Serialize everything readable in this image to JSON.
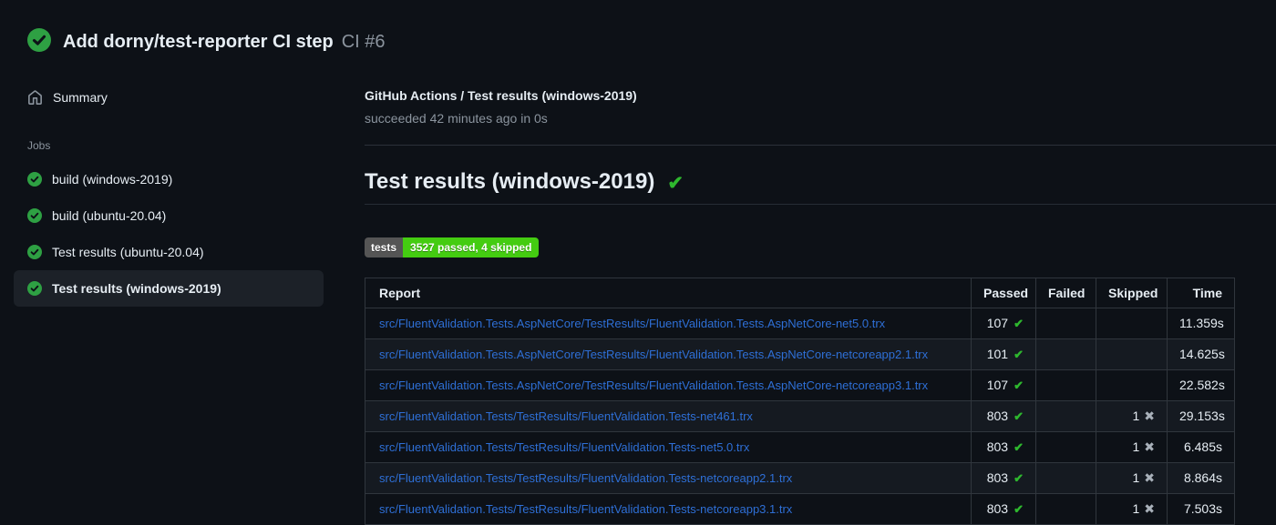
{
  "colors": {
    "success_circle": "#2ea043",
    "check_green": "#2eb82e",
    "link_blue": "#2e6fd6",
    "badge_label_bg": "#555555",
    "badge_value_bg": "#44cc11"
  },
  "run_header": {
    "title": "Add dorny/test-reporter CI step",
    "run_number": "CI #6"
  },
  "sidebar": {
    "summary_label": "Summary",
    "jobs_label": "Jobs",
    "jobs": [
      {
        "label": "build (windows-2019)",
        "status": "success",
        "selected": false
      },
      {
        "label": "build (ubuntu-20.04)",
        "status": "success",
        "selected": false
      },
      {
        "label": "Test results (ubuntu-20.04)",
        "status": "success",
        "selected": false
      },
      {
        "label": "Test results (windows-2019)",
        "status": "success",
        "selected": true
      }
    ]
  },
  "job_panel": {
    "breadcrumb": "GitHub Actions / Test results (windows-2019)",
    "status_line": "succeeded 42 minutes ago in 0s",
    "heading": "Test results (windows-2019)",
    "badge": {
      "label": "tests",
      "value": "3527 passed, 4 skipped"
    }
  },
  "results_table": {
    "columns": [
      "Report",
      "Passed",
      "Failed",
      "Skipped",
      "Time"
    ],
    "rows": [
      {
        "report": "src/FluentValidation.Tests.AspNetCore/TestResults/FluentValidation.Tests.AspNetCore-net5.0.trx",
        "passed": "107",
        "failed": "",
        "skipped": "",
        "time": "11.359s"
      },
      {
        "report": "src/FluentValidation.Tests.AspNetCore/TestResults/FluentValidation.Tests.AspNetCore-netcoreapp2.1.trx",
        "passed": "101",
        "failed": "",
        "skipped": "",
        "time": "14.625s"
      },
      {
        "report": "src/FluentValidation.Tests.AspNetCore/TestResults/FluentValidation.Tests.AspNetCore-netcoreapp3.1.trx",
        "passed": "107",
        "failed": "",
        "skipped": "",
        "time": "22.582s"
      },
      {
        "report": "src/FluentValidation.Tests/TestResults/FluentValidation.Tests-net461.trx",
        "passed": "803",
        "failed": "",
        "skipped": "1",
        "time": "29.153s"
      },
      {
        "report": "src/FluentValidation.Tests/TestResults/FluentValidation.Tests-net5.0.trx",
        "passed": "803",
        "failed": "",
        "skipped": "1",
        "time": "6.485s"
      },
      {
        "report": "src/FluentValidation.Tests/TestResults/FluentValidation.Tests-netcoreapp2.1.trx",
        "passed": "803",
        "failed": "",
        "skipped": "1",
        "time": "8.864s"
      },
      {
        "report": "src/FluentValidation.Tests/TestResults/FluentValidation.Tests-netcoreapp3.1.trx",
        "passed": "803",
        "failed": "",
        "skipped": "1",
        "time": "7.503s"
      }
    ],
    "icons": {
      "passed": "✔",
      "skipped": "✖"
    }
  }
}
